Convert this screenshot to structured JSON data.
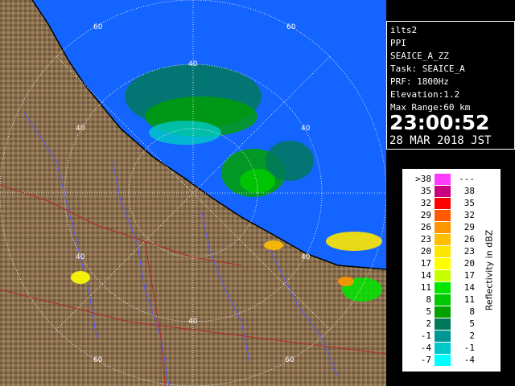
{
  "info": {
    "station": "ilts2",
    "product": "PPI",
    "scan_name": "SEAICE_A_ZZ",
    "task": "Task: SEAICE_A",
    "prf": "PRF: 1800Hz",
    "elevation": "Elevation:1.2",
    "max_range": "Max Range:60 km",
    "time": "23:00:52",
    "date": "28 MAR 2018 JST"
  },
  "legend": {
    "title": "Reflectivity in dBZ",
    "rows": [
      {
        "left": ">38",
        "right": "---",
        "color": "#ff3cff"
      },
      {
        "left": "35",
        "right": "38",
        "color": "#c8007d"
      },
      {
        "left": "32",
        "right": "35",
        "color": "#ff0000"
      },
      {
        "left": "29",
        "right": "32",
        "color": "#ff5a00"
      },
      {
        "left": "26",
        "right": "29",
        "color": "#ff9600"
      },
      {
        "left": "23",
        "right": "26",
        "color": "#ffbe00"
      },
      {
        "left": "20",
        "right": "23",
        "color": "#ffe600"
      },
      {
        "left": "17",
        "right": "20",
        "color": "#ffff00"
      },
      {
        "left": "14",
        "right": "17",
        "color": "#c8ff00"
      },
      {
        "left": "11",
        "right": "14",
        "color": "#00e600"
      },
      {
        "left": "8",
        "right": "11",
        "color": "#00c800"
      },
      {
        "left": "5",
        "right": "8",
        "color": "#00a000"
      },
      {
        "left": "2",
        "right": "5",
        "color": "#00785a"
      },
      {
        "left": "-1",
        "right": "2",
        "color": "#009696"
      },
      {
        "left": "-4",
        "right": "-1",
        "color": "#00c8c8"
      },
      {
        "left": "-7",
        "right": "-4",
        "color": "#00ffff"
      }
    ]
  },
  "range_rings": {
    "labels": [
      "60",
      "40",
      "40",
      "40",
      "40",
      "40",
      "40",
      "60",
      "60",
      "60"
    ]
  },
  "colors": {
    "sea": "#1464ff",
    "land": "#8c7250",
    "grid": "#ffffff",
    "rivers": "#5a5aff",
    "borders": "#b42828"
  }
}
